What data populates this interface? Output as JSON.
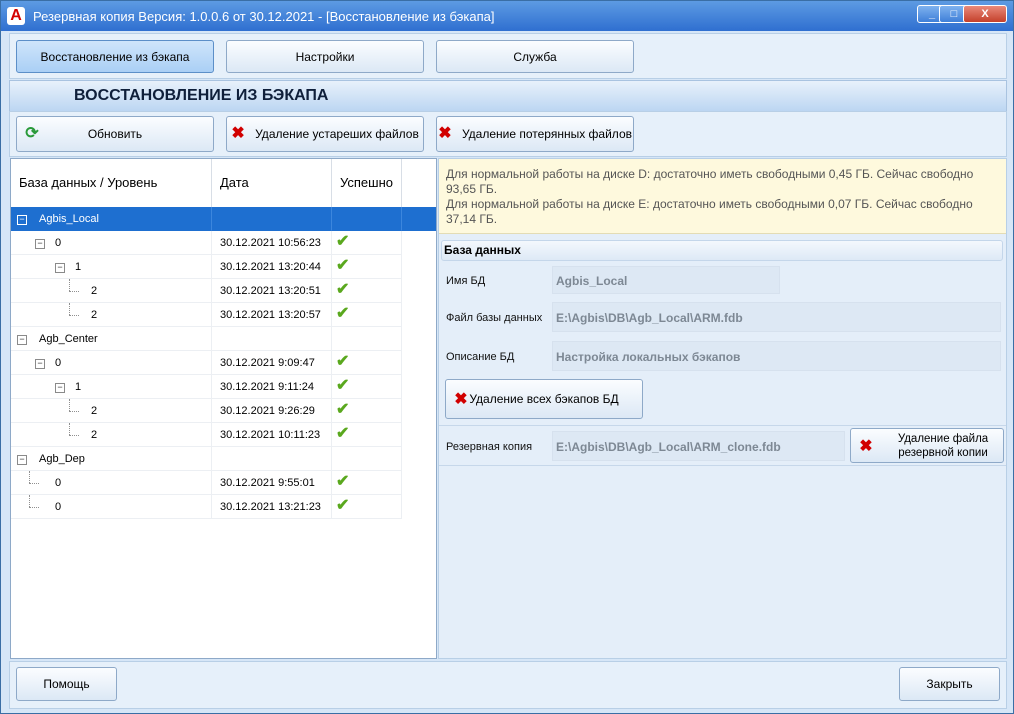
{
  "window": {
    "title": "Резервная копия   Версия: 1.0.0.6 от 30.12.2021 - [Восстановление из бэкапа]",
    "icon_letter": "A",
    "controls": {
      "minimize": "_",
      "maximize": "□",
      "close": "X"
    }
  },
  "nav": {
    "tabs": [
      {
        "label": "Восстановление из бэкапа",
        "active": true
      },
      {
        "label": "Настройки",
        "active": false
      },
      {
        "label": "Служба",
        "active": false
      }
    ]
  },
  "section_title": "ВОССТАНОВЛЕНИЕ ИЗ БЭКАПА",
  "toolbar": {
    "refresh": "Обновить",
    "delete_old": "Удаление устареших файлов",
    "delete_lost": "Удаление потерянных файлов"
  },
  "grid": {
    "headers": {
      "name": "База данных / Уровень",
      "date": "Дата",
      "ok": "Успешно"
    },
    "rows": [
      {
        "name": "Agbis_Local",
        "date": "",
        "ok": false
      },
      {
        "name": "0",
        "date": "30.12.2021 10:56:23",
        "ok": true
      },
      {
        "name": "1",
        "date": "30.12.2021 13:20:44",
        "ok": true
      },
      {
        "name": "2",
        "date": "30.12.2021 13:20:51",
        "ok": true
      },
      {
        "name": "2",
        "date": "30.12.2021 13:20:57",
        "ok": true
      },
      {
        "name": "Agb_Center",
        "date": "",
        "ok": false
      },
      {
        "name": "0",
        "date": "30.12.2021 9:09:47",
        "ok": true
      },
      {
        "name": "1",
        "date": "30.12.2021 9:11:24",
        "ok": true
      },
      {
        "name": "2",
        "date": "30.12.2021 9:26:29",
        "ok": true
      },
      {
        "name": "2",
        "date": "30.12.2021 10:11:23",
        "ok": true
      },
      {
        "name": "Agb_Dep",
        "date": "",
        "ok": false
      },
      {
        "name": "0",
        "date": "30.12.2021 9:55:01",
        "ok": true
      },
      {
        "name": "0",
        "date": "30.12.2021 13:21:23",
        "ok": true
      }
    ],
    "check_glyph": "✔"
  },
  "info": {
    "line1": "Для нормальной работы на диске D: достаточно иметь свободными 0,45 ГБ. Сейчас свободно 93,65 ГБ.",
    "line2": "Для нормальной работы на диске E: достаточно иметь свободными 0,07 ГБ. Сейчас свободно 37,14 ГБ."
  },
  "database": {
    "group_title": "База данных",
    "name_label": "Имя БД",
    "name_value": "Agbis_Local",
    "file_label": "Файл базы данных",
    "file_value": "E:\\Agbis\\DB\\Agb_Local\\ARM.fdb",
    "desc_label": "Описание БД",
    "desc_value": "Настройка локальных бэкапов",
    "delete_all": "Удаление всех бэкапов БД"
  },
  "backup": {
    "label": "Резервная копия",
    "value": "E:\\Agbis\\DB\\Agb_Local\\ARM_clone.fdb",
    "delete_line1": "Удаление файла",
    "delete_line2": "резервной копии"
  },
  "footer": {
    "help": "Помощь",
    "close": "Закрыть"
  }
}
